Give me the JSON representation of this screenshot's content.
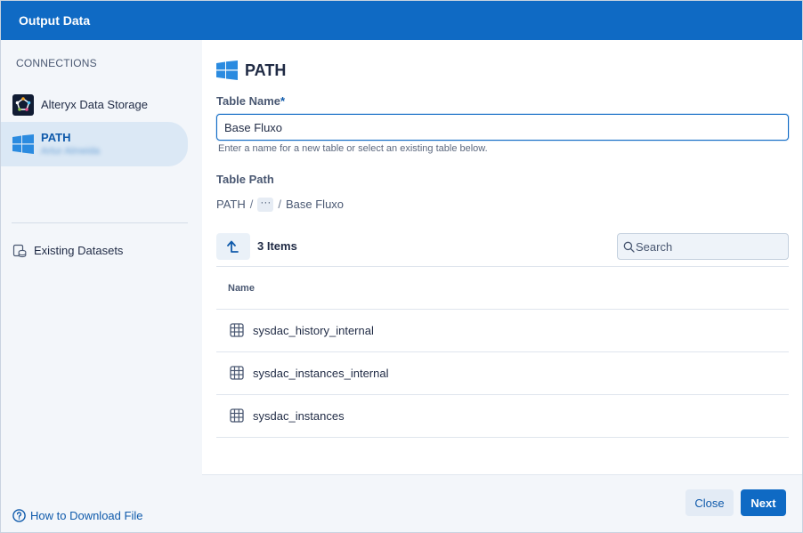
{
  "dialog": {
    "title": "Output Data"
  },
  "sidebar": {
    "section_label": "CONNECTIONS",
    "connections": [
      {
        "label": "Alteryx Data Storage",
        "icon": "alteryx-logo-icon",
        "selected": false
      },
      {
        "label": "PATH",
        "sublabel": "Artur Almeida",
        "icon": "windows-icon",
        "selected": true
      }
    ],
    "existing_label": "Existing Datasets",
    "help_link": "How to Download File"
  },
  "main": {
    "heading": "PATH",
    "table_name_label": "Table Name",
    "table_name_required_mark": "*",
    "table_name_value": "Base Fluxo",
    "table_name_hint": "Enter a name for a new table or select an existing table below.",
    "table_path_label": "Table Path",
    "breadcrumb": {
      "root": "PATH",
      "sep": "/",
      "ellipsis": "···",
      "leaf": "Base Fluxo"
    },
    "items_count": "3 Items",
    "search_placeholder": "Search",
    "column_name": "Name",
    "rows": [
      {
        "label": "sysdac_history_internal"
      },
      {
        "label": "sysdac_instances_internal"
      },
      {
        "label": "sysdac_instances"
      }
    ]
  },
  "footer": {
    "close_label": "Close",
    "next_label": "Next"
  },
  "colors": {
    "accent": "#0f6ac4",
    "sidebar_bg": "#f3f6fa",
    "selected_bg": "#dbe8f5",
    "text": "#1f2a44"
  }
}
